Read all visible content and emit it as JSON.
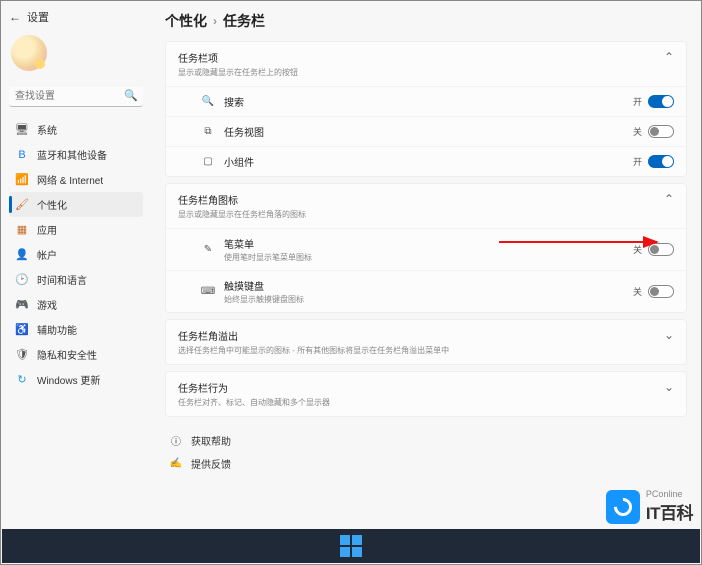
{
  "header": {
    "back_label": "设置"
  },
  "search": {
    "placeholder": "查找设置"
  },
  "sidebar": {
    "items": [
      {
        "label": "系统",
        "icon": "🖥",
        "color": "#555"
      },
      {
        "label": "蓝牙和其他设备",
        "icon": "B",
        "color": "#1f7df1"
      },
      {
        "label": "网络 & Internet",
        "icon": "📶",
        "color": "#1f9dd9"
      },
      {
        "label": "个性化",
        "icon": "🖌",
        "color": "#c86c28"
      },
      {
        "label": "应用",
        "icon": "▦",
        "color": "#c86c28"
      },
      {
        "label": "帐户",
        "icon": "👤",
        "color": "#2e9c6b"
      },
      {
        "label": "时间和语言",
        "icon": "🕑",
        "color": "#1f9dd9"
      },
      {
        "label": "游戏",
        "icon": "🎮",
        "color": "#7b5ad0"
      },
      {
        "label": "辅助功能",
        "icon": "♿",
        "color": "#1f7df1"
      },
      {
        "label": "隐私和安全性",
        "icon": "🛡",
        "color": "#555"
      },
      {
        "label": "Windows 更新",
        "icon": "↻",
        "color": "#1f9dd9"
      }
    ],
    "active_index": 3
  },
  "breadcrumb": {
    "parent": "个性化",
    "current": "任务栏"
  },
  "sections": {
    "items_card": {
      "title": "任务栏项",
      "subtitle": "显示或隐藏显示在任务栏上的按钮",
      "rows": [
        {
          "icon": "🔍",
          "label": "搜索",
          "state": "开",
          "on": true
        },
        {
          "icon": "⧉",
          "label": "任务视图",
          "state": "关",
          "on": false
        },
        {
          "icon": "▢",
          "label": "小组件",
          "state": "开",
          "on": true
        }
      ]
    },
    "corner_icons_card": {
      "title": "任务栏角图标",
      "subtitle": "显示或隐藏显示在任务栏角落的图标",
      "rows": [
        {
          "icon": "✎",
          "label": "笔菜单",
          "sub": "使用笔时显示笔菜单图标",
          "state": "关",
          "on": false
        },
        {
          "icon": "⌨",
          "label": "触摸键盘",
          "sub": "始终显示触摸键盘图标",
          "state": "关",
          "on": false
        }
      ]
    },
    "overflow_card": {
      "title": "任务栏角溢出",
      "subtitle": "选择任务栏角中可能显示的图标 - 所有其他图标将显示在任务栏角溢出菜单中"
    },
    "behavior_card": {
      "title": "任务栏行为",
      "subtitle": "任务栏对齐、标记、自动隐藏和多个显示器"
    }
  },
  "links": {
    "help": "获取帮助",
    "feedback": "提供反馈"
  },
  "watermark": {
    "line1": "PConline",
    "line2": "IT百科"
  }
}
